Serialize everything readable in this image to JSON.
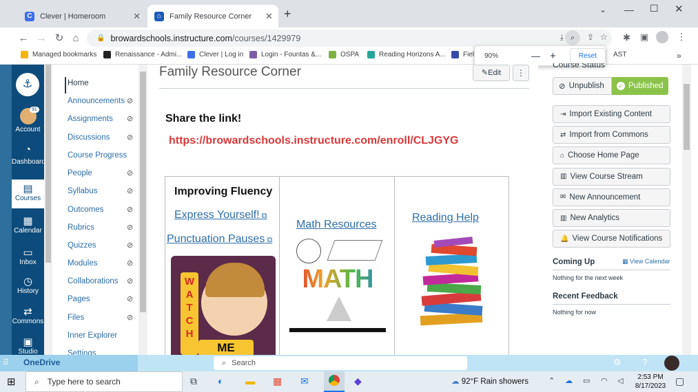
{
  "browser": {
    "tabs": [
      {
        "title": "Clever | Homeroom"
      },
      {
        "title": "Family Resource Corner"
      }
    ],
    "url_host": "browardschools.instructure.com",
    "url_path": "/courses/1429979",
    "bookmarks": [
      "Managed bookmarks",
      "Renaissance - Admi...",
      "Clever | Log in",
      "Login - Fountas &...",
      "OSPA",
      "Reading Horizons A...",
      "Field",
      "AST"
    ],
    "zoom": {
      "level": "90%",
      "minus": "—",
      "plus": "+",
      "reset": "Reset"
    }
  },
  "global_nav": {
    "badge": "91",
    "items": [
      "Account",
      "Dashboard",
      "Courses",
      "Calendar",
      "Inbox",
      "History",
      "Commons",
      "Studio"
    ]
  },
  "course_nav": {
    "items": [
      {
        "label": "Home",
        "hidden": false
      },
      {
        "label": "Announcements",
        "hidden": true
      },
      {
        "label": "Assignments",
        "hidden": true
      },
      {
        "label": "Discussions",
        "hidden": true
      },
      {
        "label": "Course Progress",
        "hidden": false
      },
      {
        "label": "People",
        "hidden": true
      },
      {
        "label": "Syllabus",
        "hidden": true
      },
      {
        "label": "Outcomes",
        "hidden": true
      },
      {
        "label": "Rubrics",
        "hidden": true
      },
      {
        "label": "Quizzes",
        "hidden": true
      },
      {
        "label": "Modules",
        "hidden": true
      },
      {
        "label": "Collaborations",
        "hidden": true
      },
      {
        "label": "Pages",
        "hidden": true
      },
      {
        "label": "Files",
        "hidden": true
      },
      {
        "label": "Inner Explorer",
        "hidden": false
      },
      {
        "label": "Settings",
        "hidden": false
      }
    ]
  },
  "main": {
    "title": "Family Resource Corner",
    "edit_label": "Edit",
    "more_label": "⋮",
    "share_heading": "Share the link!",
    "share_link": "https://browardschools.instructure.com/enroll/CLJGYG",
    "col1": {
      "heading": "Improving Fluency",
      "link1": "Express Yourself!",
      "link2": "Punctuation Pauses",
      "sign_top": "WATCH",
      "sign_bottom": "ME"
    },
    "col2": {
      "link": "Math Resources",
      "image_text": "MATH"
    },
    "col3": {
      "link": "Reading Help"
    }
  },
  "right_sidebar": {
    "course_status": "Course Status",
    "unpublish": "Unpublish",
    "published": "Published",
    "buttons": [
      "Import Existing Content",
      "Import from Commons",
      "Choose Home Page",
      "View Course Stream",
      "New Announcement",
      "New Analytics",
      "View Course Notifications"
    ],
    "coming_up": "Coming Up",
    "view_calendar": "View Calendar",
    "nothing_week": "Nothing for the next week",
    "recent_feedback": "Recent Feedback",
    "nothing_now": "Nothing for now"
  },
  "onedrive": {
    "label": "OneDrive",
    "search": "Search"
  },
  "taskbar": {
    "search_placeholder": "Type here to search",
    "weather": "92°F  Rain showers",
    "time": "2:53 PM",
    "date": "8/17/2023"
  },
  "colors": {
    "canvas_nav": "#0c4b7b",
    "link": "#2d6ea8",
    "share_link": "#d9383a",
    "published": "#8bc34a"
  }
}
